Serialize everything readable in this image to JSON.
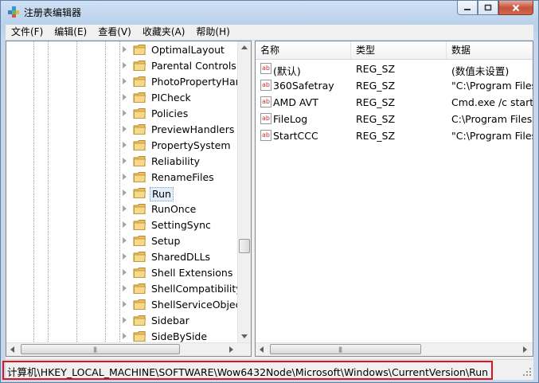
{
  "window": {
    "title": "注册表编辑器",
    "icon": "registry-editor-icon",
    "accent": "#b9d1ea",
    "close_color": "#c7523b",
    "highlight_color": "#e0141e"
  },
  "menu": [
    {
      "label": "文件(F)"
    },
    {
      "label": "编辑(E)"
    },
    {
      "label": "查看(V)"
    },
    {
      "label": "收藏夹(A)"
    },
    {
      "label": "帮助(H)"
    }
  ],
  "tree": {
    "items": [
      {
        "label": "OptimalLayout"
      },
      {
        "label": "Parental Controls"
      },
      {
        "label": "PhotoPropertyHand"
      },
      {
        "label": "PICheck"
      },
      {
        "label": "Policies"
      },
      {
        "label": "PreviewHandlers"
      },
      {
        "label": "PropertySystem"
      },
      {
        "label": "Reliability"
      },
      {
        "label": "RenameFiles"
      },
      {
        "label": "Run"
      },
      {
        "label": "RunOnce"
      },
      {
        "label": "SettingSync"
      },
      {
        "label": "Setup"
      },
      {
        "label": "SharedDLLs"
      },
      {
        "label": "Shell Extensions"
      },
      {
        "label": "ShellCompatibility"
      },
      {
        "label": "ShellServiceObjectD"
      },
      {
        "label": "Sidebar"
      },
      {
        "label": "SideBySide"
      }
    ],
    "selected": "Run"
  },
  "list": {
    "columns": [
      "名称",
      "类型",
      "数据"
    ],
    "rows": [
      {
        "name": "(默认)",
        "type": "REG_SZ",
        "data": "(数值未设置)"
      },
      {
        "name": "360Safetray",
        "type": "REG_SZ",
        "data": "\"C:\\Program Files"
      },
      {
        "name": "AMD AVT",
        "type": "REG_SZ",
        "data": "Cmd.exe /c start"
      },
      {
        "name": "FileLog",
        "type": "REG_SZ",
        "data": "C:\\Program Files"
      },
      {
        "name": "StartCCC",
        "type": "REG_SZ",
        "data": "\"C:\\Program Files"
      }
    ],
    "value_icon": "string-value-icon"
  },
  "status": {
    "path": "计算机\\HKEY_LOCAL_MACHINE\\SOFTWARE\\Wow6432Node\\Microsoft\\Windows\\CurrentVersion\\Run"
  }
}
